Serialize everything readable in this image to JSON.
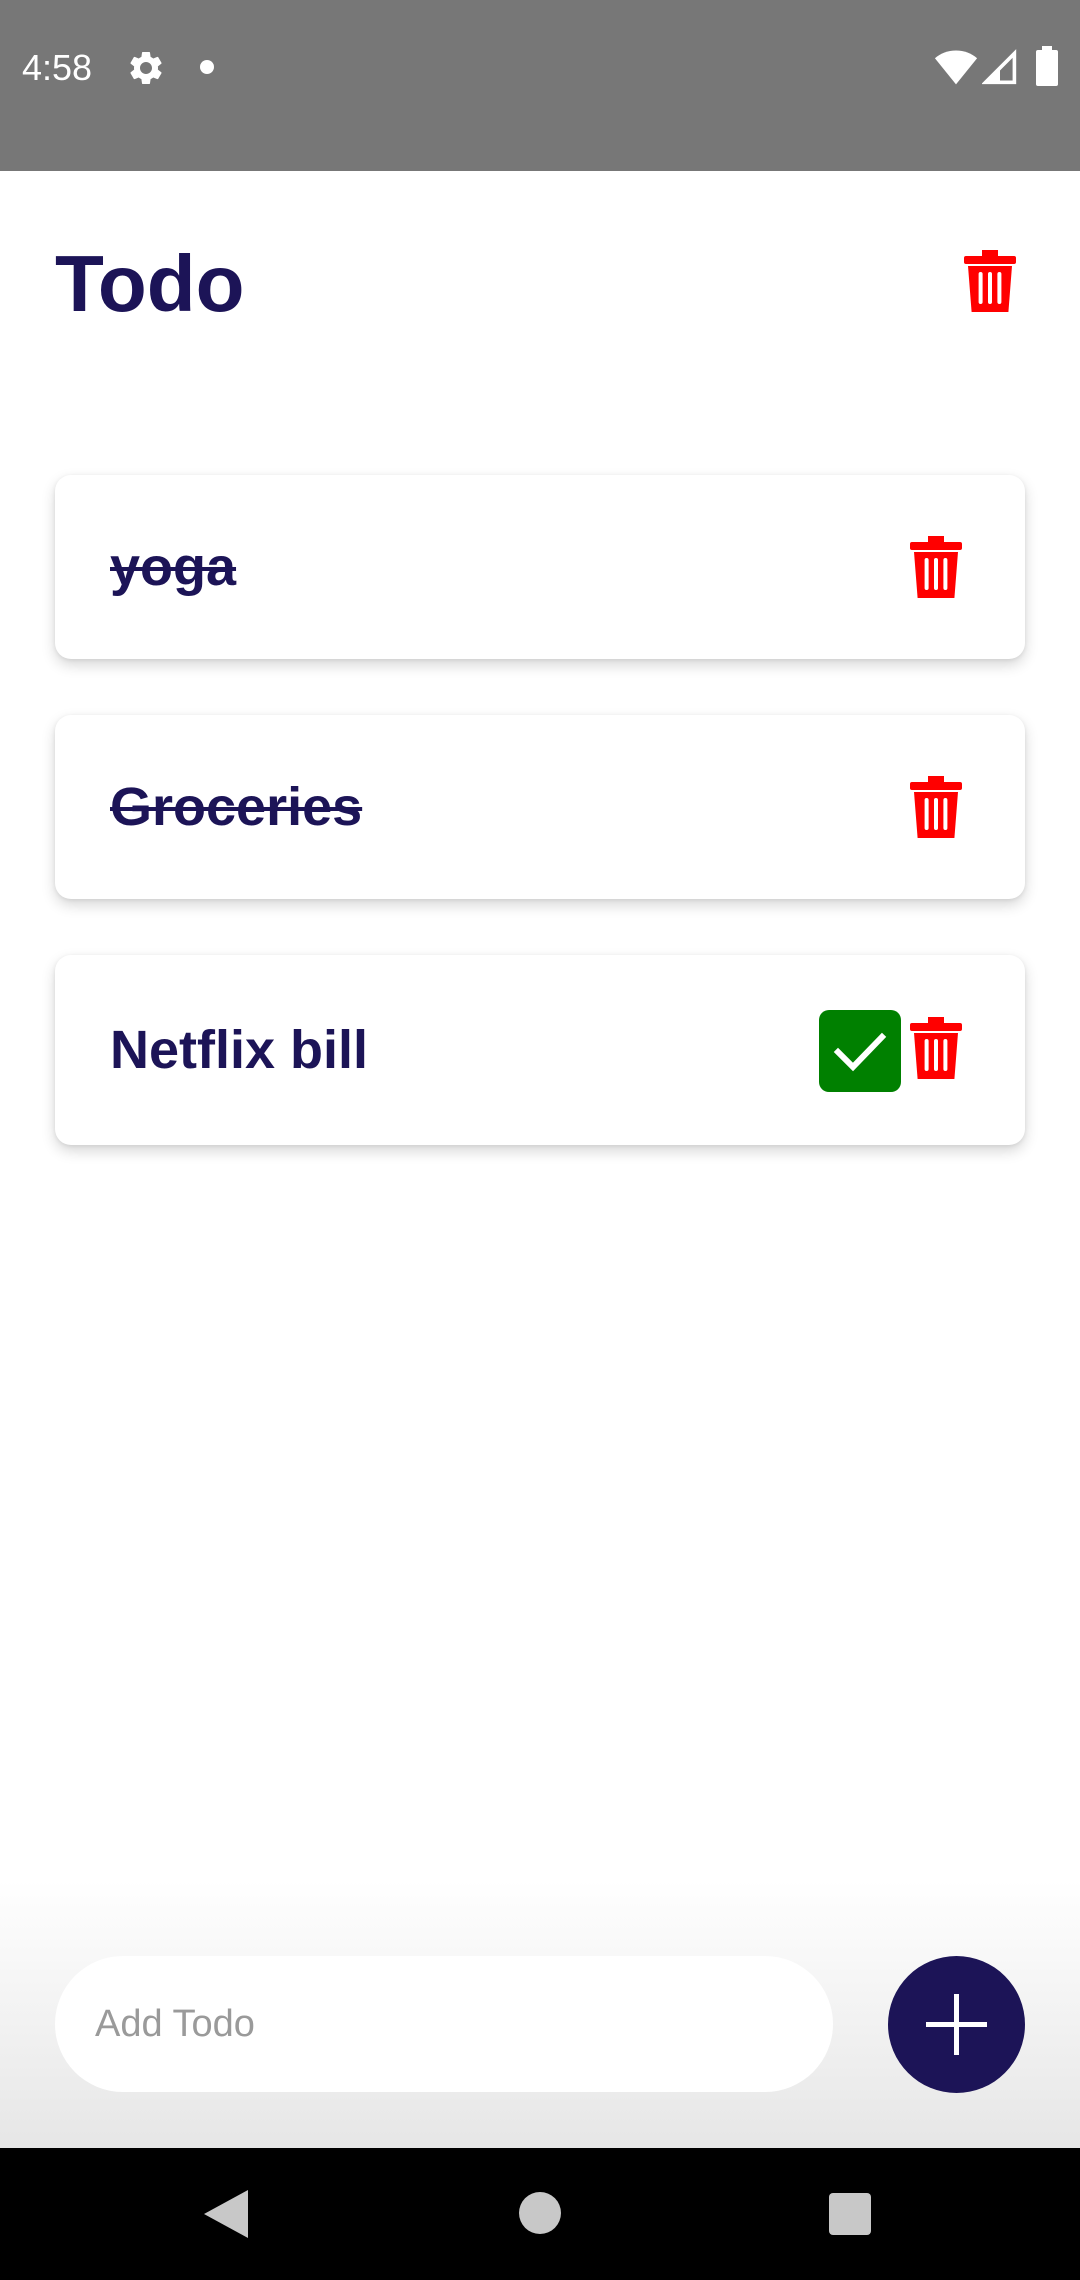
{
  "status_bar": {
    "time": "4:58",
    "icons": [
      "gear-icon",
      "notification-dot-icon",
      "wifi-icon",
      "signal-icon",
      "battery-icon"
    ]
  },
  "header": {
    "title": "Todo",
    "delete_all_icon": "trash-icon"
  },
  "todos": [
    {
      "text": "yoga",
      "completed": true
    },
    {
      "text": "Groceries",
      "completed": true
    },
    {
      "text": "Netflix bill",
      "completed": false
    }
  ],
  "add_todo": {
    "placeholder": "Add Todo",
    "value": "",
    "button_icon": "plus-icon"
  },
  "nav_bar": {
    "icons": [
      "back-icon",
      "home-icon",
      "recents-icon"
    ]
  },
  "colors": {
    "primary": "#1c1457",
    "delete": "#ff0000",
    "check": "#008000",
    "status_bar": "#777777"
  }
}
